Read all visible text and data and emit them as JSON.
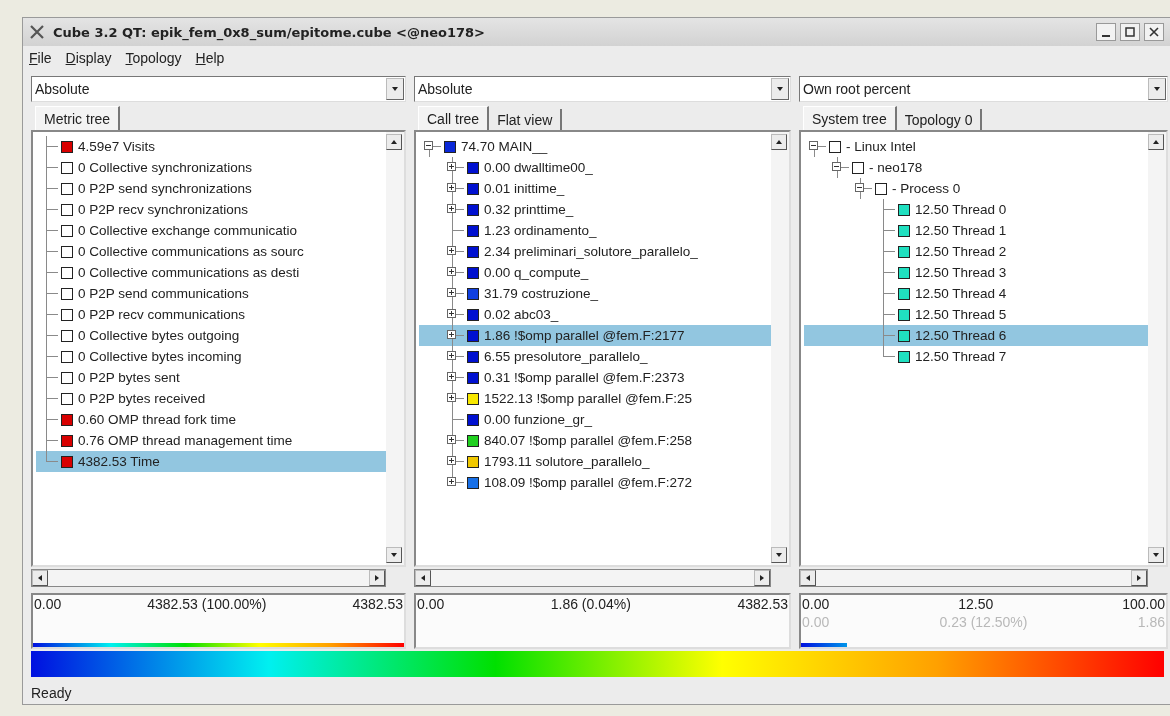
{
  "window": {
    "title": "Cube 3.2 QT: epik_fem_0x8_sum/epitome.cube <@neo178>"
  },
  "menu": [
    "File",
    "Display",
    "Topology",
    "Help"
  ],
  "panes": [
    {
      "mode": "Absolute",
      "tabs": [
        {
          "label": "Metric tree",
          "selected": true
        }
      ],
      "tree": [
        {
          "label": "4.59e7 Visits",
          "color": "#d80000",
          "selected": false
        },
        {
          "label": "0 Collective synchronizations",
          "color": "#ffffff",
          "selected": false
        },
        {
          "label": "0 P2P send synchronizations",
          "color": "#ffffff",
          "selected": false
        },
        {
          "label": "0 P2P recv synchronizations",
          "color": "#ffffff",
          "selected": false
        },
        {
          "label": "0 Collective exchange communicatio",
          "color": "#ffffff",
          "selected": false
        },
        {
          "label": "0 Collective communications as sourc",
          "color": "#ffffff",
          "selected": false
        },
        {
          "label": "0 Collective communications as desti",
          "color": "#ffffff",
          "selected": false
        },
        {
          "label": "0 P2P send communications",
          "color": "#ffffff",
          "selected": false
        },
        {
          "label": "0 P2P recv communications",
          "color": "#ffffff",
          "selected": false
        },
        {
          "label": "0 Collective bytes outgoing",
          "color": "#ffffff",
          "selected": false
        },
        {
          "label": "0 Collective bytes incoming",
          "color": "#ffffff",
          "selected": false
        },
        {
          "label": "0 P2P bytes sent",
          "color": "#ffffff",
          "selected": false
        },
        {
          "label": "0 P2P bytes received",
          "color": "#ffffff",
          "selected": false
        },
        {
          "label": "0.60 OMP thread fork time",
          "color": "#d80000",
          "selected": false
        },
        {
          "label": "0.76 OMP thread management time",
          "color": "#d80000",
          "selected": false
        },
        {
          "label": "4382.53 Time",
          "color": "#d80000",
          "selected": true
        }
      ],
      "scale": {
        "min": "0.00",
        "value": "4382.53 (100.00%)",
        "max": "4382.53",
        "level": 1
      }
    },
    {
      "mode": "Absolute",
      "tabs": [
        {
          "label": "Call tree",
          "selected": true
        },
        {
          "label": "Flat view",
          "selected": false
        }
      ],
      "tree": [
        {
          "label": "74.70 MAIN__",
          "color": "#0a28d8",
          "selected": false,
          "expanded": true,
          "children": [
            {
              "label": "0.00 dwalltime00_",
              "color": "#0010d0",
              "selected": false,
              "expanded": false
            },
            {
              "label": "0.01 inittime_",
              "color": "#0010d0",
              "selected": false,
              "expanded": false
            },
            {
              "label": "0.32 printtime_",
              "color": "#0010d0",
              "selected": false,
              "expanded": false
            },
            {
              "label": "1.23 ordinamento_",
              "color": "#0010d0",
              "selected": false
            },
            {
              "label": "2.34 preliminari_solutore_parallelo_",
              "color": "#0010d0",
              "selected": false,
              "expanded": false
            },
            {
              "label": "0.00 q_compute_",
              "color": "#0010d0",
              "selected": false,
              "expanded": false
            },
            {
              "label": "31.79 costruzione_",
              "color": "#1040e0",
              "selected": false,
              "expanded": false
            },
            {
              "label": "0.02 abc03_",
              "color": "#0010d0",
              "selected": false,
              "expanded": false
            },
            {
              "label": "1.86 !$omp parallel @fem.F:2177",
              "color": "#0010d0",
              "selected": true,
              "expanded": false
            },
            {
              "label": "6.55 presolutore_parallelo_",
              "color": "#0010d0",
              "selected": false,
              "expanded": false
            },
            {
              "label": "0.31 !$omp parallel @fem.F:2373",
              "color": "#0010d0",
              "selected": false,
              "expanded": false
            },
            {
              "label": "1522.13 !$omp parallel @fem.F:25",
              "color": "#f8e800",
              "selected": false,
              "expanded": false
            },
            {
              "label": "0.00 funzione_gr_",
              "color": "#0010d0",
              "selected": false
            },
            {
              "label": "840.07 !$omp parallel @fem.F:258",
              "color": "#20d020",
              "selected": false,
              "expanded": false
            },
            {
              "label": "1793.11 solutore_parallelo_",
              "color": "#f0c800",
              "selected": false,
              "expanded": false
            },
            {
              "label": "108.09 !$omp parallel @fem.F:272",
              "color": "#1870e8",
              "selected": false,
              "expanded": false
            }
          ]
        }
      ],
      "scale": {
        "min": "0.00",
        "value": "1.86 (0.04%)",
        "max": "4382.53"
      }
    },
    {
      "mode": "Own root percent",
      "tabs": [
        {
          "label": "System tree",
          "selected": true
        },
        {
          "label": "Topology 0",
          "selected": false
        }
      ],
      "tree": [
        {
          "label": "- Linux Intel",
          "color": "#ffffff",
          "selected": false,
          "expanded": true,
          "children": [
            {
              "label": "- neo178",
              "color": "#ffffff",
              "selected": false,
              "expanded": true,
              "children": [
                {
                  "label": "- Process 0",
                  "color": "#ffffff",
                  "selected": false,
                  "expanded": true,
                  "children": [
                    {
                      "label": "12.50 Thread 0",
                      "color": "#20e0c0",
                      "selected": false
                    },
                    {
                      "label": "12.50 Thread 1",
                      "color": "#20e0c0",
                      "selected": false
                    },
                    {
                      "label": "12.50 Thread 2",
                      "color": "#20e0c0",
                      "selected": false
                    },
                    {
                      "label": "12.50 Thread 3",
                      "color": "#20e0c0",
                      "selected": false
                    },
                    {
                      "label": "12.50 Thread 4",
                      "color": "#20e0c0",
                      "selected": false
                    },
                    {
                      "label": "12.50 Thread 5",
                      "color": "#20e0c0",
                      "selected": false
                    },
                    {
                      "label": "12.50 Thread 6",
                      "color": "#20e0c0",
                      "selected": true
                    },
                    {
                      "label": "12.50 Thread 7",
                      "color": "#20e0c0",
                      "selected": false
                    }
                  ]
                }
              ]
            }
          ]
        }
      ],
      "scale": {
        "min": "0.00",
        "value": "12.50",
        "max": "100.00",
        "level": 0.125,
        "secondary": {
          "min": "0.00",
          "value": "0.23 (12.50%)",
          "max": "1.86"
        }
      }
    }
  ],
  "status_bar": "Ready"
}
